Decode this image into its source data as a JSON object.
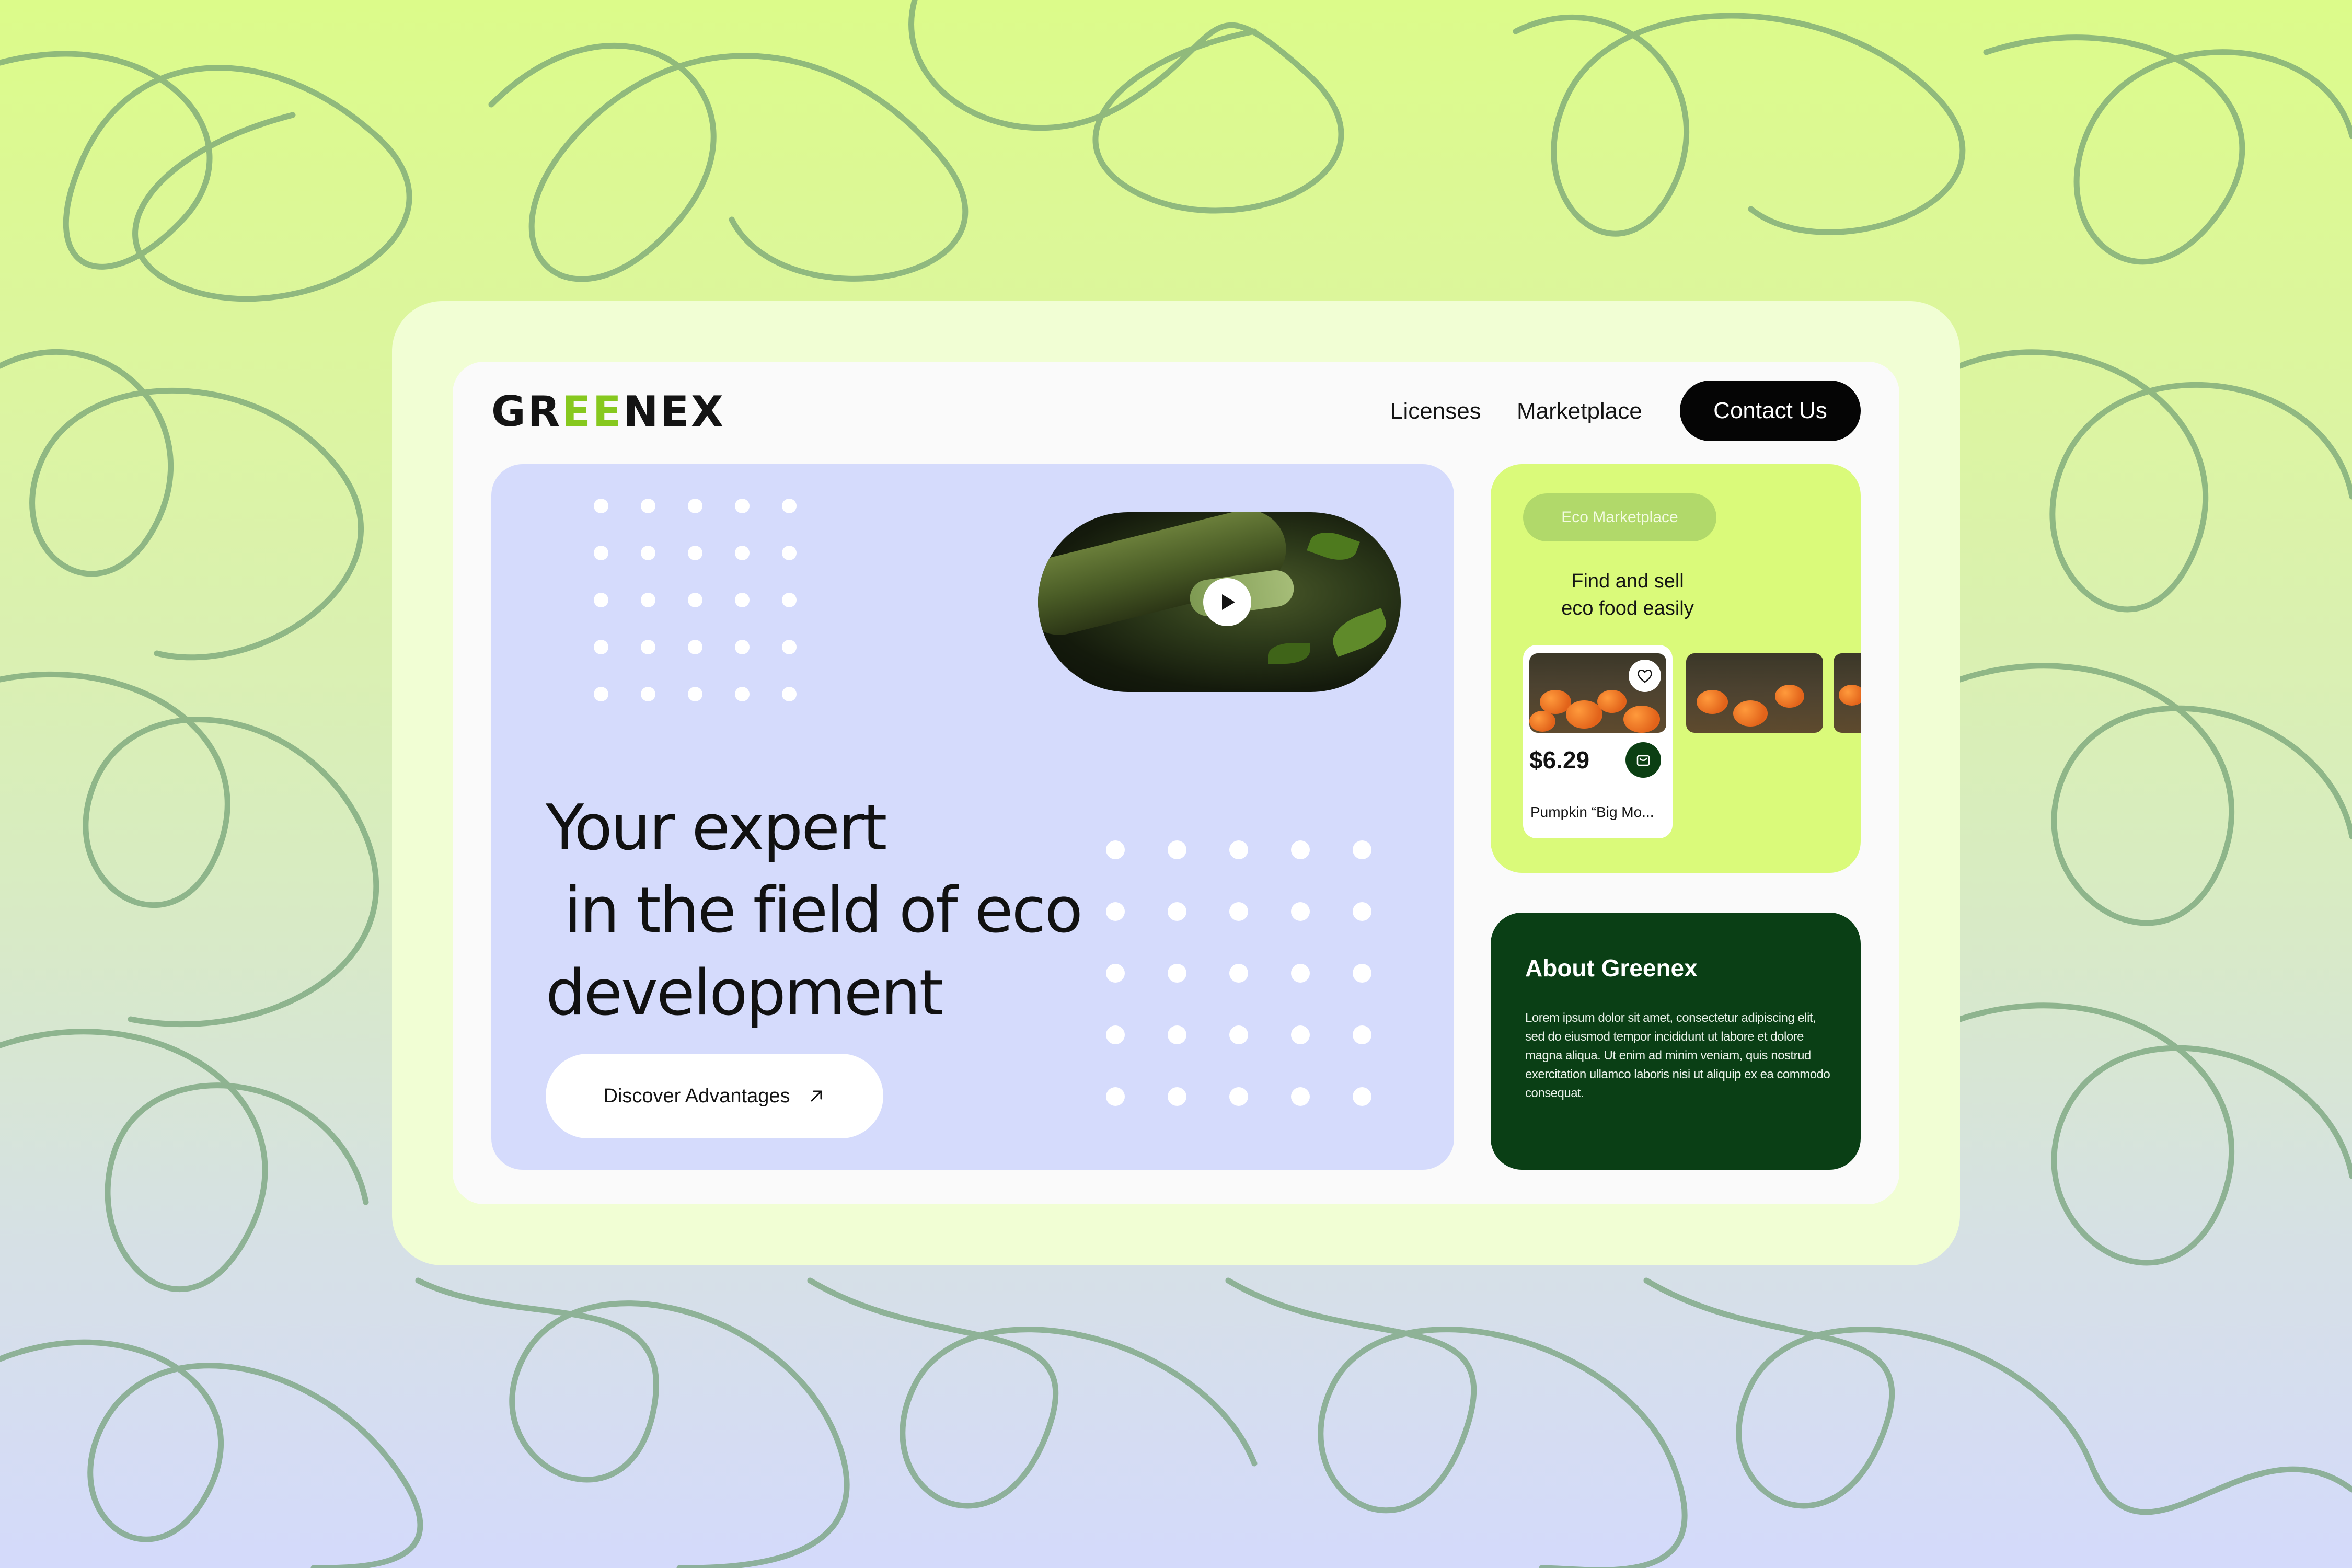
{
  "brand": {
    "logo_part1": "GR",
    "logo_part2": "EE",
    "logo_part3": "NEX",
    "accent": "#86c81e"
  },
  "nav": {
    "licenses": "Licenses",
    "marketplace": "Marketplace",
    "contact": "Contact Us"
  },
  "hero": {
    "headline_lines": [
      "Your expert",
      " in the field of eco",
      "development"
    ],
    "cta": "Discover Advantages",
    "cta_icon": "arrow-up-right-icon",
    "video_icon": "play-icon",
    "background": "#d5dbfc"
  },
  "market": {
    "badge": "Eco Marketplace",
    "title_line1": "Find and sell",
    "title_line2": "eco food easily",
    "product": {
      "price": "$6.29",
      "name": "Pumpkin “Big Mo...",
      "icons": [
        "heart-icon",
        "cart-icon"
      ]
    },
    "background": "#dafa7a"
  },
  "about": {
    "title": "About Greenex",
    "text": "Lorem ipsum dolor sit amet, consectetur adipiscing elit, sed do eiusmod tempor incididunt ut labore et dolore magna aliqua. Ut enim ad minim veniam, quis nostrud exercitation ullamco laboris nisi ut aliquip ex ea commodo consequat.",
    "background": "#0a3f15"
  }
}
